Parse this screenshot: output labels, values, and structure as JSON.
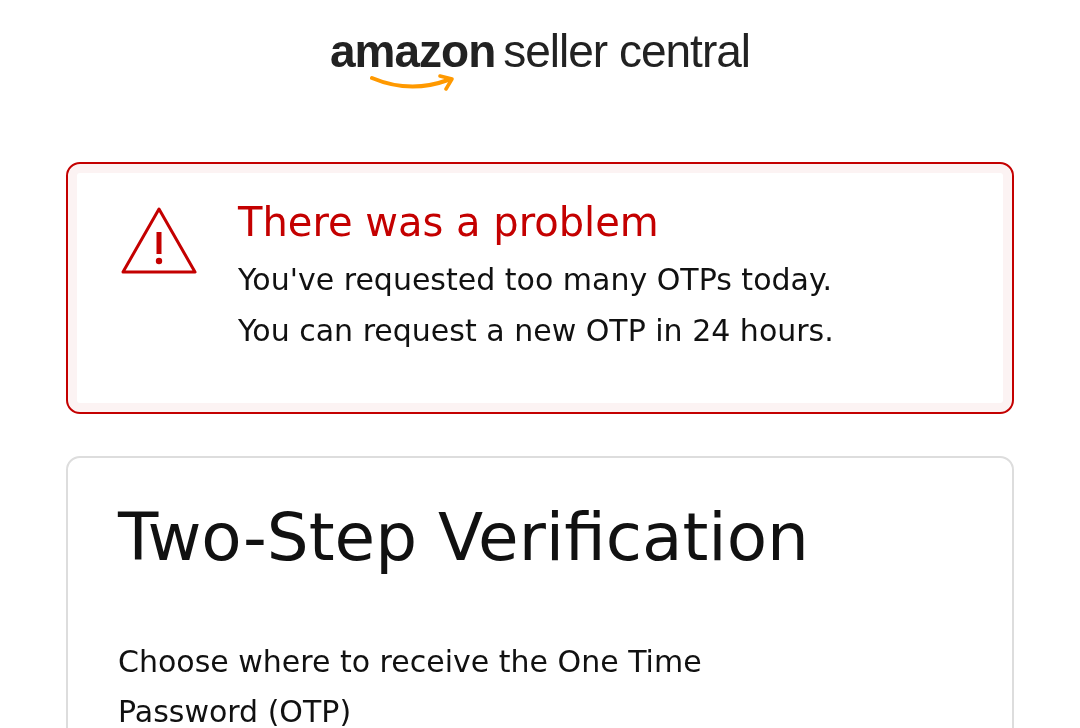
{
  "logo": {
    "brand": "amazon",
    "product": "seller central"
  },
  "alert": {
    "title": "There was a problem",
    "lines": [
      "You've requested too many OTPs today.",
      "You can request a new OTP in 24 hours."
    ]
  },
  "card": {
    "heading": "Two-Step Verification",
    "instruction": "Choose where to receive the One Time Password (OTP)"
  }
}
